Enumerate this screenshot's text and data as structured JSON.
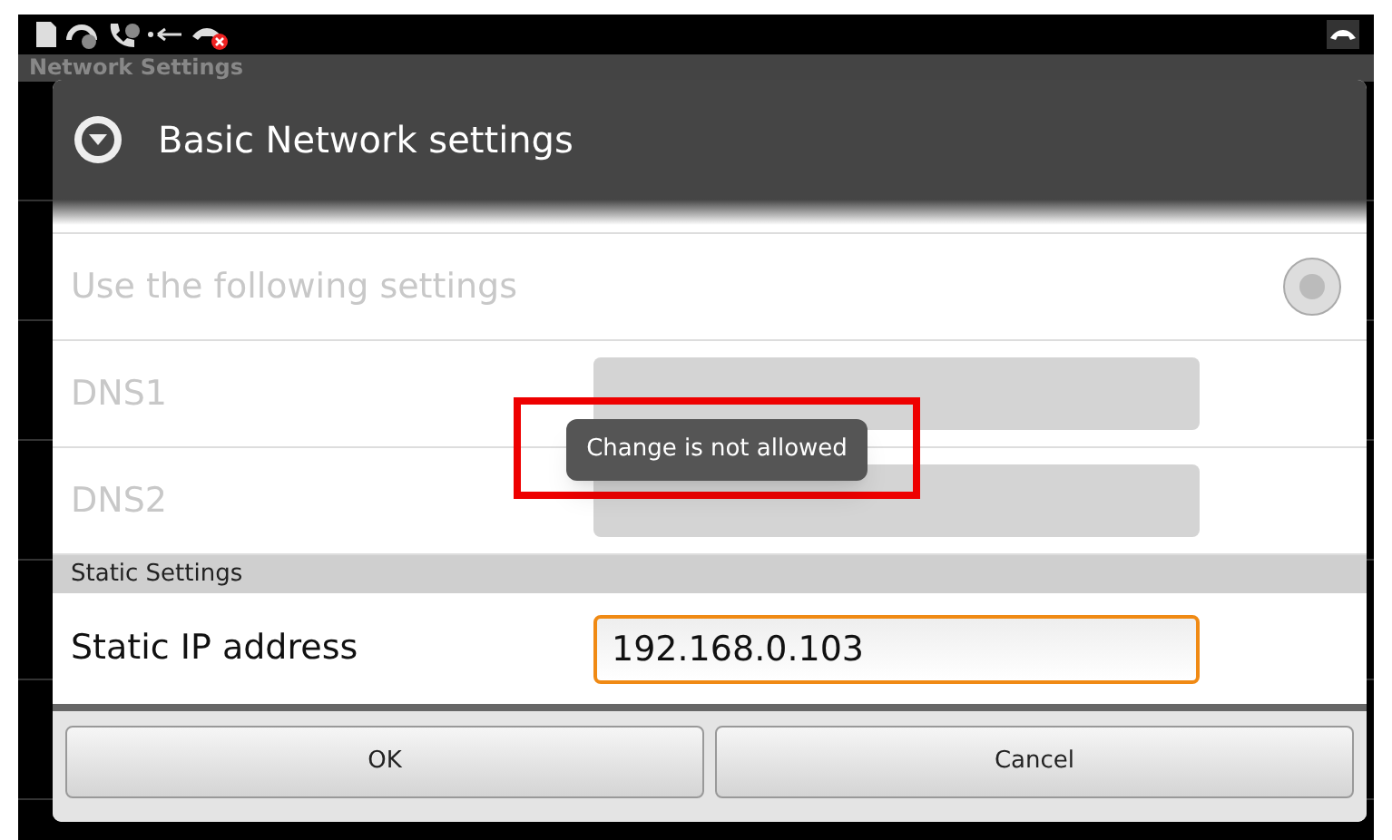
{
  "app_bar": {
    "title": "Network Settings"
  },
  "dialog": {
    "title": "Basic Network settings",
    "options": [
      {
        "label": "Use the following settings",
        "selected": false,
        "disabled": true
      }
    ],
    "dns_fields": [
      {
        "label": "DNS1",
        "disabled": true
      },
      {
        "label": "DNS2",
        "disabled": true
      }
    ],
    "section": "Static Settings",
    "static_ip": {
      "label": "Static IP address",
      "value": "192.168.0.103",
      "focused": true
    },
    "buttons": [
      "OK",
      "Cancel"
    ]
  },
  "toast": {
    "text": "Change is not allowed",
    "highlighted": true
  }
}
